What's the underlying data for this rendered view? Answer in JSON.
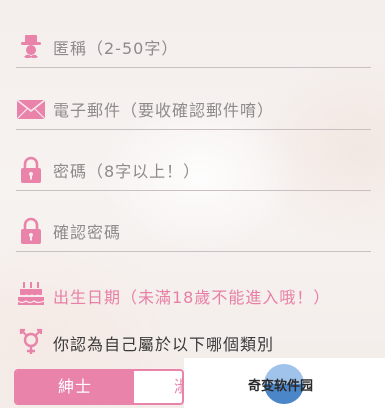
{
  "form": {
    "nickname": {
      "placeholder": "匿稱（2-50字）",
      "icon": "gentleman-icon"
    },
    "email": {
      "placeholder": "電子郵件（要收確認郵件唷）",
      "icon": "envelope-icon"
    },
    "password": {
      "placeholder": "密碼（8字以上！）",
      "icon": "lock-icon"
    },
    "confirm_password": {
      "placeholder": "確認密碼",
      "icon": "lock-icon"
    },
    "birthday": {
      "label": "出生日期（未滿18歲不能進入哦！）",
      "icon": "birthday-cake-icon"
    },
    "gender": {
      "question": "你認為自己屬於以下哪個類別",
      "icon": "gender-symbol-icon",
      "options": [
        {
          "label": "紳士",
          "selected": true
        },
        {
          "label": "淑",
          "selected": false
        }
      ]
    }
  },
  "watermark": {
    "text": "奇变软件园"
  },
  "colors": {
    "accent": "#e983aa",
    "placeholder": "#8f8b8b",
    "underline": "#c9c1c1",
    "question_text": "#3a3a3a"
  }
}
